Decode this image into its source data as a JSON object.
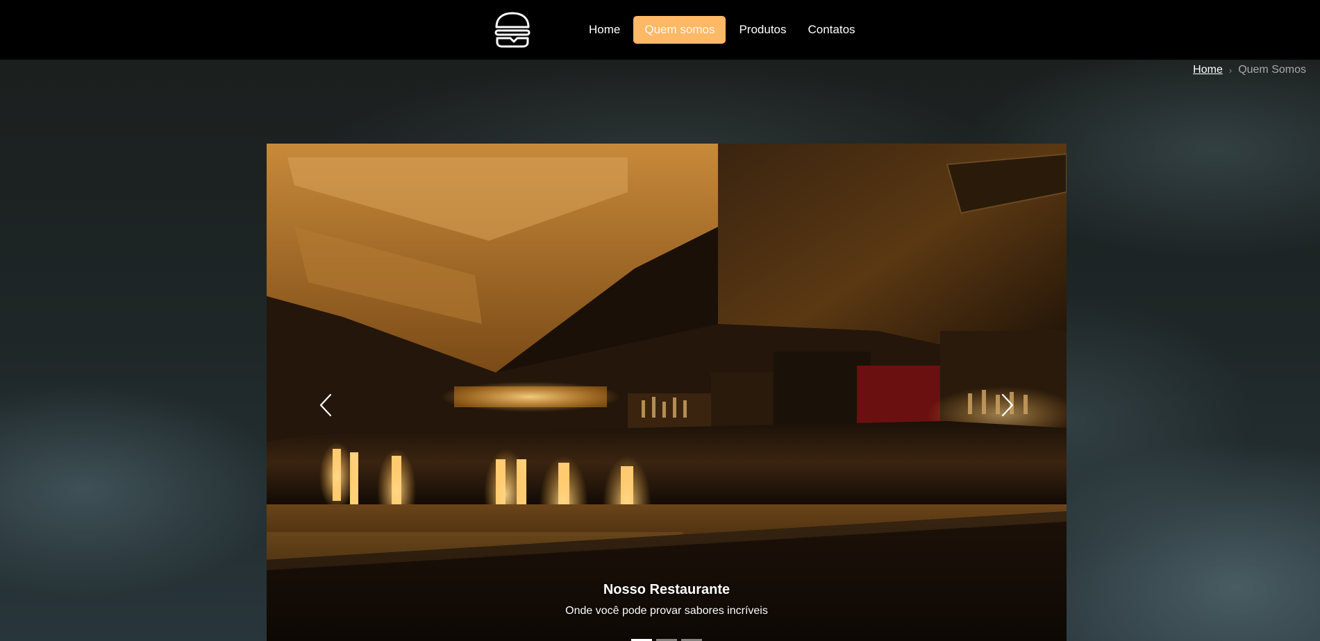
{
  "nav": {
    "items": [
      {
        "label": "Home",
        "active": false
      },
      {
        "label": "Quem somos",
        "active": true
      },
      {
        "label": "Produtos",
        "active": false
      },
      {
        "label": "Contatos",
        "active": false
      }
    ]
  },
  "breadcrumb": {
    "home": "Home",
    "current": "Quem Somos"
  },
  "carousel": {
    "slides": [
      {
        "title": "Nosso Restaurante",
        "text": "Onde você pode provar sabores incríveis"
      }
    ],
    "indicator_count": 3,
    "active_index": 0
  },
  "colors": {
    "navbar_bg": "#000000",
    "accent": "#ffb866",
    "page_bg": "#1d2324"
  },
  "icons": {
    "logo": "burger-icon",
    "prev": "chevron-left-icon",
    "next": "chevron-right-icon",
    "breadcrumb_separator": "chevron-right-icon"
  }
}
